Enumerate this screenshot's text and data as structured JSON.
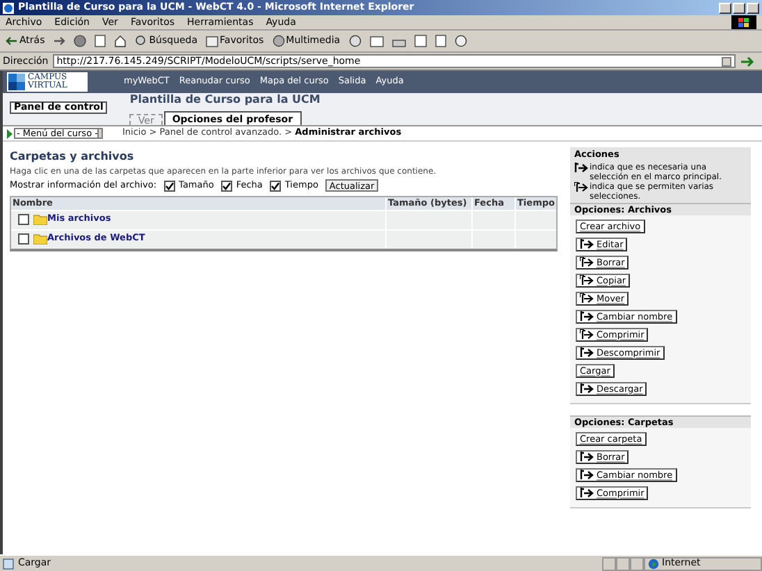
{
  "window": {
    "title": "Plantilla de Curso para la UCM - WebCT 4.0 - Microsoft Internet Explorer"
  },
  "menu": [
    "Archivo",
    "Edición",
    "Ver",
    "Favoritos",
    "Herramientas",
    "Ayuda"
  ],
  "toolbar": {
    "back": "Atrás",
    "search": "Búsqueda",
    "favorites": "Favoritos",
    "media": "Multimedia"
  },
  "address": {
    "label": "Dirección",
    "value": "http://217.76.145.249/SCRIPT/ModeloUCM/scripts/serve_home"
  },
  "banner": {
    "logo_top": "CAMPUS",
    "logo_bottom": "VIRTUAL",
    "links": [
      "myWebCT",
      "Reanudar curso",
      "Mapa del curso",
      "Salida",
      "Ayuda"
    ]
  },
  "header": {
    "panel_button": "Panel de control",
    "course_title": "Plantilla de Curso para la UCM",
    "tabs": [
      {
        "label": "Ver",
        "selected": false
      },
      {
        "label": "Opciones del profesor",
        "selected": true
      }
    ]
  },
  "course_menu": {
    "value": "- Menú del curso -"
  },
  "breadcrumb": {
    "path": "Inicio > Panel de control avanzado. > ",
    "current": "Administrar archivos"
  },
  "main": {
    "title": "Carpetas y archivos",
    "hint": "Haga clic en una de las carpetas que aparecen en la parte inferior para ver los archivos que contiene.",
    "show_label": "Mostrar información del archivo:",
    "options": [
      {
        "label": "Tamaño",
        "checked": true
      },
      {
        "label": "Fecha",
        "checked": true
      },
      {
        "label": "Tiempo",
        "checked": true
      }
    ],
    "update_button": "Actualizar",
    "columns": [
      "Nombre",
      "Tamaño (bytes)",
      "Fecha",
      "Tiempo"
    ],
    "rows": [
      {
        "name": "Mis archivos",
        "checked": false
      },
      {
        "name": "Archivos de WebCT",
        "checked": false
      }
    ]
  },
  "sidebar": {
    "title": "Acciones",
    "legend": [
      {
        "kind": "single",
        "text": "indica que es necesaria una selección en el marco principal."
      },
      {
        "kind": "multi",
        "text": "indica que se permiten varias selecciones."
      }
    ],
    "sections": [
      {
        "title": "Opciones: Archivos",
        "buttons": [
          {
            "label": "Crear archivo",
            "kind": "none"
          },
          {
            "label": "Editar",
            "kind": "single"
          },
          {
            "label": "Borrar",
            "kind": "multi"
          },
          {
            "label": "Copiar",
            "kind": "multi"
          },
          {
            "label": "Mover",
            "kind": "multi"
          },
          {
            "label": "Cambiar nombre",
            "kind": "single"
          },
          {
            "label": "Comprimir",
            "kind": "multi"
          },
          {
            "label": "Descomprimir",
            "kind": "single"
          },
          {
            "label": "Cargar",
            "kind": "none"
          },
          {
            "label": "Descargar",
            "kind": "single"
          }
        ]
      },
      {
        "title": "Opciones: Carpetas",
        "buttons": [
          {
            "label": "Crear carpeta",
            "kind": "none"
          },
          {
            "label": "Borrar",
            "kind": "single"
          },
          {
            "label": "Cambiar nombre",
            "kind": "single"
          },
          {
            "label": "Comprimir",
            "kind": "single"
          }
        ]
      }
    ]
  },
  "status_bar": {
    "text": "Cargar",
    "zone": "Internet"
  }
}
